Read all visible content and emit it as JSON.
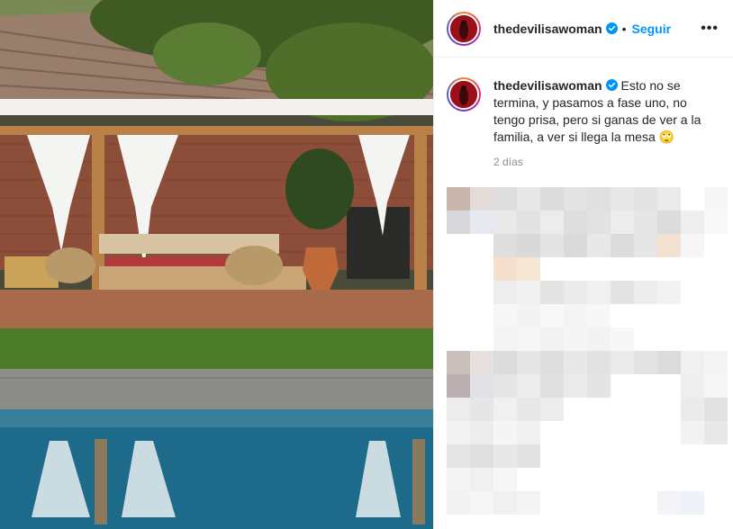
{
  "post": {
    "username": "thedevilisawoman",
    "follow_label": "Seguir",
    "separator": "•",
    "more_label": "•••",
    "caption": "Esto no se termina, y pasamos a fase uno, no tengo prisa, pero si ganas de ver a la familia, a ver si llega la mesa 🙄",
    "time_ago": "2 días"
  },
  "icons": {
    "verified": "verified-badge-icon",
    "more": "more-options-icon"
  },
  "colors": {
    "link_blue": "#0095f6",
    "verified_blue": "#0095f6",
    "pool_blue": "#1d6a8a",
    "muted_text": "#8e8e8e"
  }
}
